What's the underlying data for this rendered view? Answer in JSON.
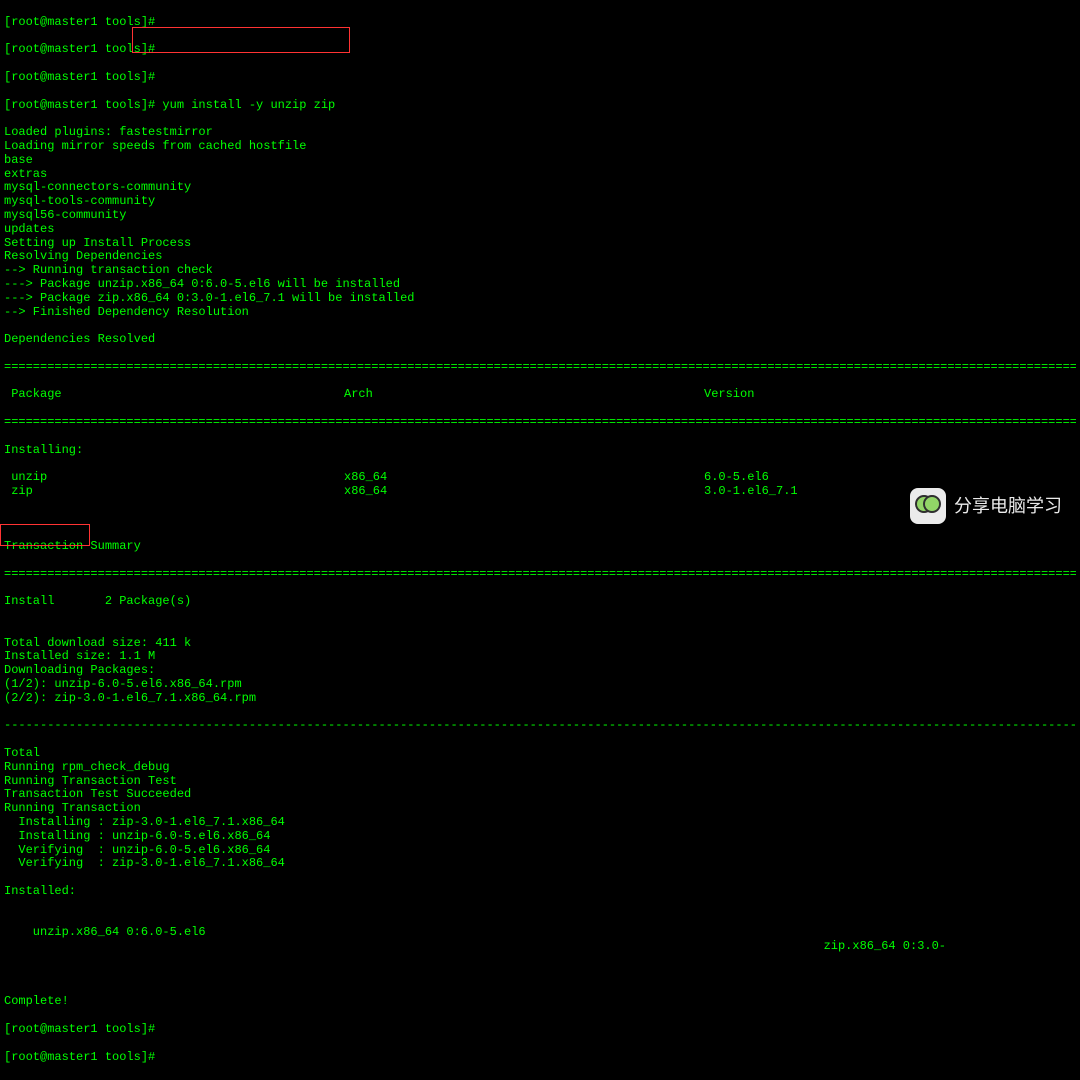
{
  "prompt1": "[root@master1 tools]#",
  "prompt2": "[root@master1 tools]#",
  "prompt3": "[root@master1 tools]#",
  "prompt_cmd": "[root@master1 tools]# yum install -y unzip zip",
  "lines_top": [
    "Loaded plugins: fastestmirror",
    "Loading mirror speeds from cached hostfile",
    "base",
    "extras",
    "mysql-connectors-community",
    "mysql-tools-community",
    "mysql56-community",
    "updates",
    "Setting up Install Process",
    "Resolving Dependencies",
    "--> Running transaction check",
    "---> Package unzip.x86_64 0:6.0-5.el6 will be installed",
    "---> Package zip.x86_64 0:3.0-1.el6_7.1 will be installed",
    "--> Finished Dependency Resolution",
    "",
    "Dependencies Resolved"
  ],
  "hr": "============================================================================================================================================================================",
  "table": {
    "headers": {
      "package": " Package",
      "arch": "Arch",
      "version": "Version"
    },
    "section": "Installing:",
    "rows": [
      {
        "package": " unzip",
        "arch": "x86_64",
        "version": "6.0-5.el6"
      },
      {
        "package": " zip",
        "arch": "x86_64",
        "version": "3.0-1.el6_7.1"
      }
    ]
  },
  "tx_summary": "Transaction Summary",
  "install_count": "Install       2 Package(s)",
  "lines_mid": [
    "",
    "Total download size: 411 k",
    "Installed size: 1.1 M",
    "Downloading Packages:",
    "(1/2): unzip-6.0-5.el6.x86_64.rpm",
    "(2/2): zip-3.0-1.el6_7.1.x86_64.rpm"
  ],
  "dashline": "-----------------------------------------------------------------------------------------------------------------------------------------------------------------------------",
  "lines_after": [
    "Total",
    "Running rpm_check_debug",
    "Running Transaction Test",
    "Transaction Test Succeeded",
    "Running Transaction",
    "  Installing : zip-3.0-1.el6_7.1.x86_64",
    "  Installing : unzip-6.0-5.el6.x86_64",
    "  Verifying  : unzip-6.0-5.el6.x86_64",
    "  Verifying  : zip-3.0-1.el6_7.1.x86_64",
    "",
    "Installed:"
  ],
  "inst_left": "  unzip.x86_64 0:6.0-5.el6",
  "inst_right": "zip.x86_64 0:3.0-",
  "complete": "Complete!",
  "prompt_end1": "[root@master1 tools]#",
  "prompt_end2": "[root@master1 tools]#",
  "watermark": "分享电脑学习"
}
